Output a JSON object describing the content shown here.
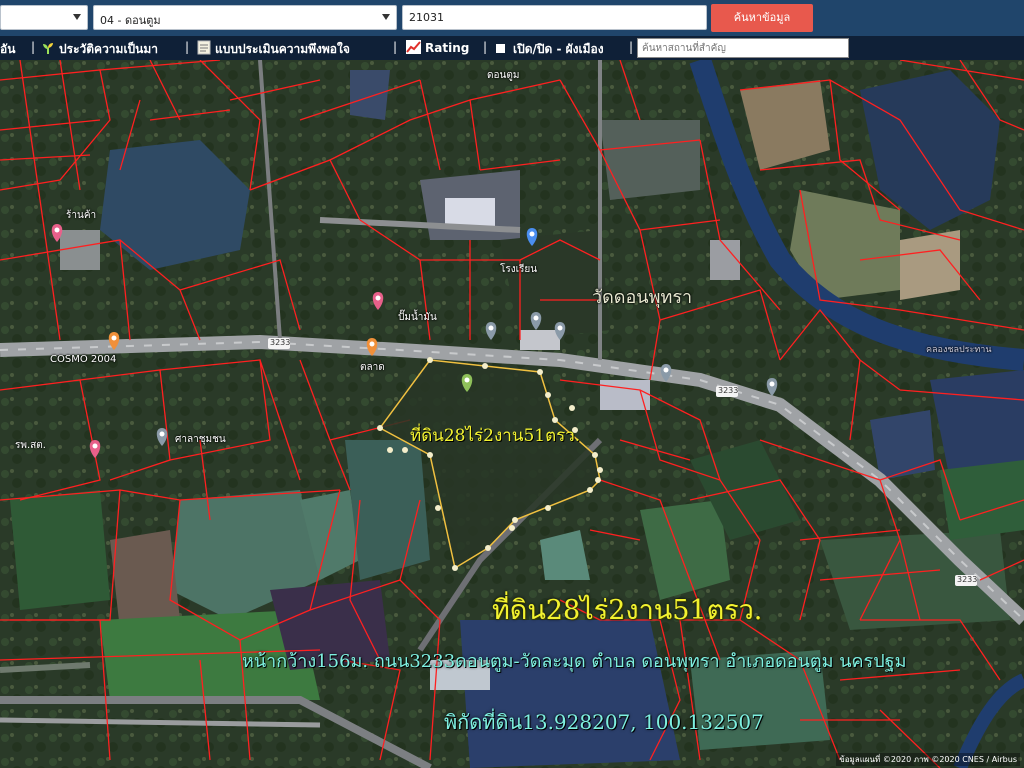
{
  "search": {
    "province_value": "",
    "district_value": "04 - ดอนตูม",
    "code_value": "21031",
    "search_button": "ค้นหาข้อมูล"
  },
  "menu": {
    "item_partial": "อัน",
    "history": "ประวัติความเป็นมา",
    "survey": "แบบประเมินความพึงพอใจ",
    "rating": "Rating",
    "toggle_layer": "เปิด/ปิด - ผังเมือง",
    "place_placeholder": "ค้นหาสถานที่สำคัญ"
  },
  "map": {
    "places": {
      "dontum_road_label": "ดอนตูม",
      "school_label": "โรงเรียน",
      "temple_label": "วัดดอนพุทรา",
      "pin_shop": "ร้านค้า",
      "pin_cosmo": "COSMO 2004",
      "pin_health": "รพ.สต.",
      "pin_station": "ปั๊มน้ำมัน",
      "pin_market": "ตลาด",
      "pin_community": "ศาลาชุมชน",
      "road_canal": "คลองชลประทาน",
      "route_3233_a": "3233",
      "route_3233_b": "3233",
      "route_3233_c": "3233"
    },
    "plot_label_small": "ที่ดิน28ไร่2งาน51ตรว.",
    "overlay_line1": "ที่ดิน28ไร่2งาน51ตรว.",
    "overlay_line2": "หน้ากว้าง156ม. ถนน3233ดอนตูม-วัดละมุด ตำบล ดอนพุทรา อำเภอดอนตูม นครปฐม",
    "overlay_line3": "พิกัดที่ดิน13.928207, 100.132507",
    "attribution": "ข้อมูลแผนที่ ©2020 ภาพ ©2020 CNES / Airbus"
  },
  "colors": {
    "topbar": "#20456b",
    "menubar": "#0f2037",
    "search_button": "#e8594d",
    "parcel_lines": "#ff2020",
    "plot_outline": "#f0c040",
    "overlay_title": "#f2f230",
    "overlay_text": "#7ef0e0"
  }
}
